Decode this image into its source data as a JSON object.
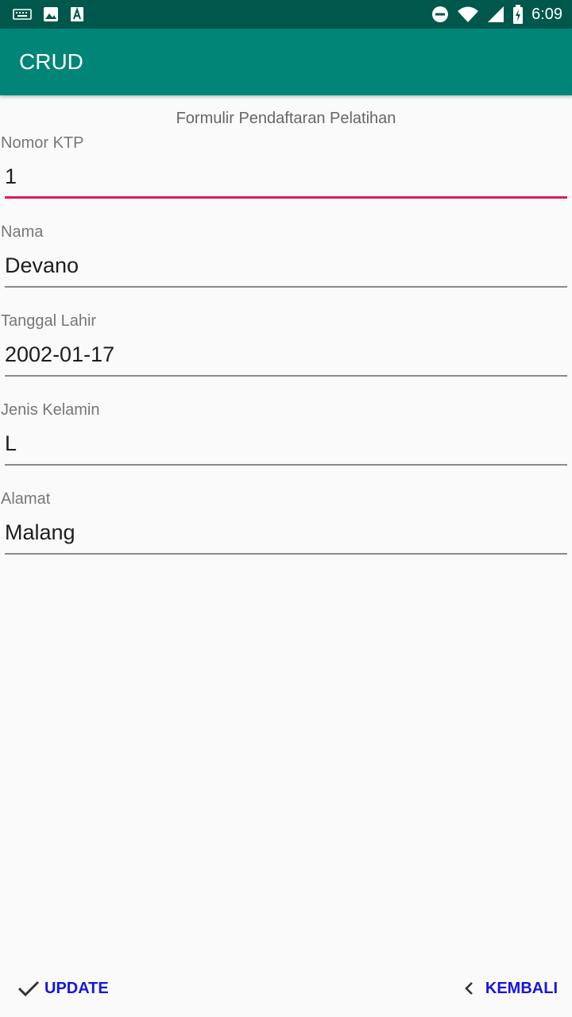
{
  "status_bar": {
    "time": "6:09",
    "icons": [
      "keyboard-icon",
      "image-icon",
      "font-icon",
      "do-not-disturb-icon",
      "wifi-icon",
      "signal-icon",
      "battery-icon"
    ]
  },
  "app_bar": {
    "title": "CRUD"
  },
  "form": {
    "title": "Formulir Pendaftaran Pelatihan",
    "fields": [
      {
        "label": "Nomor KTP",
        "value": "1"
      },
      {
        "label": "Nama",
        "value": "Devano"
      },
      {
        "label": "Tanggal Lahir",
        "value": "2002-01-17"
      },
      {
        "label": "Jenis Kelamin",
        "value": "L"
      },
      {
        "label": "Alamat",
        "value": "Malang"
      }
    ]
  },
  "actions": {
    "update_label": "UPDATE",
    "back_label": "KEMBALI"
  },
  "colors": {
    "status_bar": "#00574b",
    "app_bar": "#008577",
    "accent": "#d81b60",
    "button_text": "#1515e0"
  }
}
